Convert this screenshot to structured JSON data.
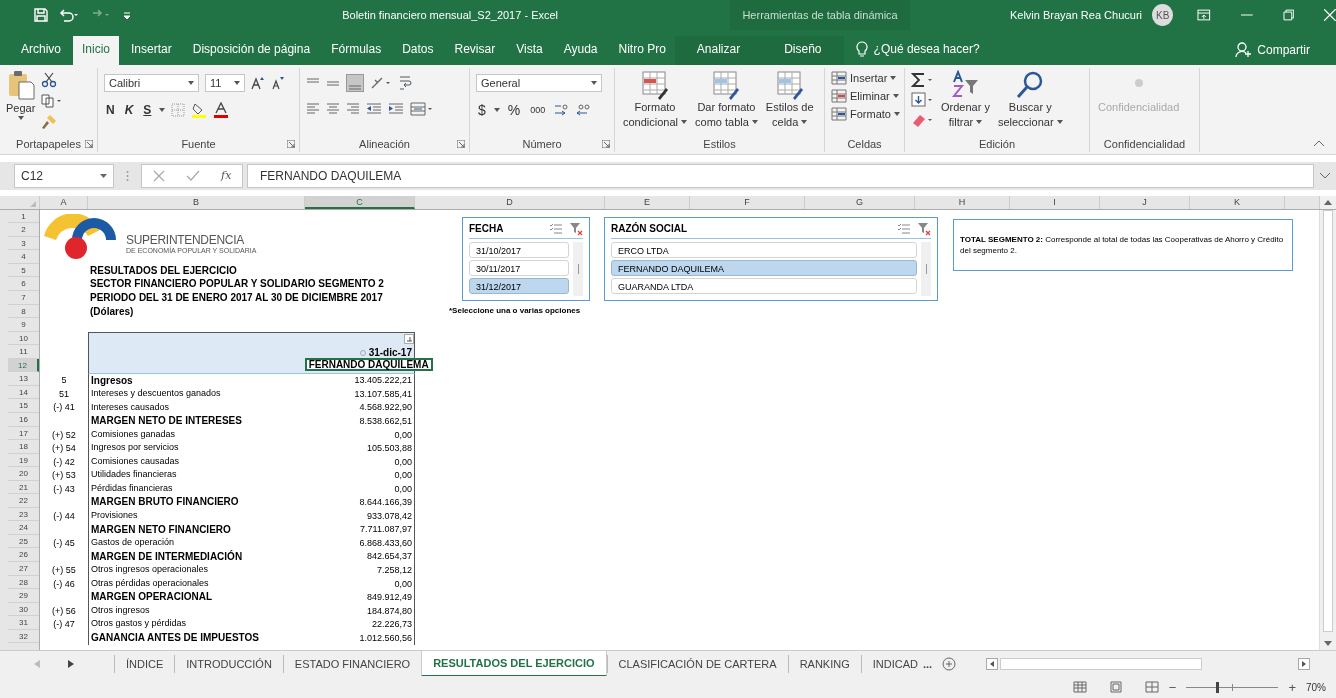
{
  "window": {
    "title": "Boletin financiero mensual_S2_2017  -  Excel",
    "context_group": "Herramientas de tabla dinámica",
    "user": "Kelvin Brayan Rea Chucuri",
    "user_initials": "KB"
  },
  "ribbon_tabs": [
    {
      "label": "Archivo",
      "selected": false,
      "context": false
    },
    {
      "label": "Inicio",
      "selected": true,
      "context": false
    },
    {
      "label": "Insertar",
      "selected": false,
      "context": false
    },
    {
      "label": "Disposición de página",
      "selected": false,
      "context": false
    },
    {
      "label": "Fórmulas",
      "selected": false,
      "context": false
    },
    {
      "label": "Datos",
      "selected": false,
      "context": false
    },
    {
      "label": "Revisar",
      "selected": false,
      "context": false
    },
    {
      "label": "Vista",
      "selected": false,
      "context": false
    },
    {
      "label": "Ayuda",
      "selected": false,
      "context": false
    },
    {
      "label": "Nitro Pro",
      "selected": false,
      "context": false
    },
    {
      "label": "Analizar",
      "selected": false,
      "context": true
    },
    {
      "label": "Diseño",
      "selected": false,
      "context": true
    }
  ],
  "tell_me": "¿Qué desea hacer?",
  "share": "Compartir",
  "clipboard": {
    "paste": "Pegar",
    "label": "Portapapeles"
  },
  "font": {
    "name": "Calibri",
    "size": "11",
    "bold": "N",
    "italic": "K",
    "underline": "S",
    "label": "Fuente"
  },
  "alignment": {
    "label": "Alineación"
  },
  "number": {
    "format": "General",
    "currency": "$",
    "percent": "%",
    "thousands": "000",
    "label": "Número"
  },
  "styles": {
    "buttons": [
      [
        "Formato",
        "condicional"
      ],
      [
        "Dar formato",
        "como tabla"
      ],
      [
        "Estilos de",
        "celda"
      ]
    ],
    "label": "Estilos"
  },
  "cells": {
    "buttons": [
      "Insertar",
      "Eliminar",
      "Formato"
    ],
    "label": "Celdas"
  },
  "editing": {
    "buttons": [
      [
        "Ordenar y",
        "filtrar"
      ],
      [
        "Buscar y",
        "seleccionar"
      ]
    ],
    "label": "Edición"
  },
  "sensitivity": {
    "button": "Confidencialidad",
    "label": "Confidencialidad"
  },
  "formula_bar": {
    "name_box": "C12",
    "function_symbol": "fx",
    "content": "FERNANDO DAQUILEMA"
  },
  "columns": [
    {
      "label": "A",
      "selected": false
    },
    {
      "label": "B",
      "selected": false
    },
    {
      "label": "C",
      "selected": true
    },
    {
      "label": "D",
      "selected": false
    },
    {
      "label": "E",
      "selected": false
    },
    {
      "label": "F",
      "selected": false
    },
    {
      "label": "G",
      "selected": false
    },
    {
      "label": "H",
      "selected": false
    },
    {
      "label": "I",
      "selected": false
    },
    {
      "label": "J",
      "selected": false
    },
    {
      "label": "K",
      "selected": false
    }
  ],
  "row_headers": [
    {
      "label": "1",
      "selected": false
    },
    {
      "label": "2",
      "selected": false
    },
    {
      "label": "3",
      "selected": false
    },
    {
      "label": "4",
      "selected": false
    },
    {
      "label": "5",
      "selected": false
    },
    {
      "label": "6",
      "selected": false
    },
    {
      "label": "7",
      "selected": false
    },
    {
      "label": "8",
      "selected": false
    },
    {
      "label": "9",
      "selected": false
    },
    {
      "label": "10",
      "selected": false
    },
    {
      "label": "11",
      "selected": false
    },
    {
      "label": "12",
      "selected": true
    },
    {
      "label": "13",
      "selected": false
    },
    {
      "label": "14",
      "selected": false
    },
    {
      "label": "15",
      "selected": false
    },
    {
      "label": "16",
      "selected": false
    },
    {
      "label": "17",
      "selected": false
    },
    {
      "label": "18",
      "selected": false
    },
    {
      "label": "19",
      "selected": false
    },
    {
      "label": "20",
      "selected": false
    },
    {
      "label": "21",
      "selected": false
    },
    {
      "label": "22",
      "selected": false
    },
    {
      "label": "23",
      "selected": false
    },
    {
      "label": "24",
      "selected": false
    },
    {
      "label": "25",
      "selected": false
    },
    {
      "label": "26",
      "selected": false
    },
    {
      "label": "27",
      "selected": false
    },
    {
      "label": "28",
      "selected": false
    },
    {
      "label": "29",
      "selected": false
    },
    {
      "label": "30",
      "selected": false
    },
    {
      "label": "31",
      "selected": false
    },
    {
      "label": "32",
      "selected": false
    }
  ],
  "logo": {
    "name": "SUPERINTENDENCIA",
    "subtitle": "DE ECONOMÍA POPULAR Y SOLIDARIA"
  },
  "report_titles": [
    "RESULTADOS DEL EJERCICIO",
    "SECTOR FINANCIERO POPULAR Y SOLIDARIO SEGMENTO 2",
    "PERIODO DEL 31 DE ENERO 2017 AL 30 DE DICIEMBRE 2017",
    "(Dólares)"
  ],
  "pivot": {
    "date_header": "31-dic-17",
    "column_header": "FERNANDO DAQUILEMA",
    "rows": [
      {
        "code": "5",
        "label": "Ingresos",
        "value": "13.405.222,21",
        "bold": true
      },
      {
        "code": "51",
        "label": "Intereses y descuentos ganados",
        "value": "13.107.585,41",
        "bold": false
      },
      {
        "code": "(-) 41",
        "label": "Intereses causados",
        "value": "4.568.922,90",
        "bold": false
      },
      {
        "label": "MARGEN NETO DE INTERESES",
        "value": "8.538.662,51",
        "bold": true
      },
      {
        "code": "(+) 52",
        "label": "Comisiones ganadas",
        "value": "0,00",
        "bold": false
      },
      {
        "code": "(+) 54",
        "label": "Ingresos por servicios",
        "value": "105.503,88",
        "bold": false
      },
      {
        "code": "(-) 42",
        "label": "Comisiones causadas",
        "value": "0,00",
        "bold": false
      },
      {
        "code": "(+) 53",
        "label": "Utilidades financieras",
        "value": "0,00",
        "bold": false
      },
      {
        "code": "(-) 43",
        "label": "Pérdidas financieras",
        "value": "0,00",
        "bold": false
      },
      {
        "label": "MARGEN BRUTO FINANCIERO",
        "value": "8.644.166,39",
        "bold": true
      },
      {
        "code": "(-) 44",
        "label": "Provisiones",
        "value": "933.078,42",
        "bold": false
      },
      {
        "label": "MARGEN NETO FINANCIERO",
        "value": "7.711.087,97",
        "bold": true
      },
      {
        "code": "(-) 45",
        "label": "Gastos de operación",
        "value": "6.868.433,60",
        "bold": false
      },
      {
        "label": "MARGEN DE INTERMEDIACIÓN",
        "value": "842.654,37",
        "bold": true
      },
      {
        "code": "(+) 55",
        "label": "Otros ingresos operacionales",
        "value": "7.258,12",
        "bold": false
      },
      {
        "code": "(-) 46",
        "label": "Otras pérdidas operacionales",
        "value": "0,00",
        "bold": false
      },
      {
        "label": "MARGEN OPERACIONAL",
        "value": "849.912,49",
        "bold": true
      },
      {
        "code": "(+) 56",
        "label": "Otros ingresos",
        "value": "184.874,80",
        "bold": false
      },
      {
        "code": "(-) 47",
        "label": "Otros gastos y pérdidas",
        "value": "22.226,73",
        "bold": false
      },
      {
        "label": "GANANCIA ANTES DE IMPUESTOS",
        "value": "1.012.560,56",
        "bold": true
      }
    ]
  },
  "slicers": [
    {
      "title": "FECHA",
      "items": [
        {
          "label": "31/10/2017",
          "selected": false
        },
        {
          "label": "30/11/2017",
          "selected": false
        },
        {
          "label": "31/12/2017",
          "selected": true
        }
      ]
    },
    {
      "title": "RAZÓN SOCIAL",
      "items": [
        {
          "label": "ERCO LTDA",
          "selected": false
        },
        {
          "label": "FERNANDO DAQUILEMA",
          "selected": true
        },
        {
          "label": "GUARANDA LTDA",
          "selected": false
        }
      ]
    }
  ],
  "slicer_note": "*Seleccione una o varias opciones",
  "note_box": "**TOTAL SEGMENTO 2:**  Corresponde al total de todas las Cooperativas  de Ahorro y Crédito del segmento 2.",
  "sheet_tabs": [
    {
      "label": "ÍNDICE",
      "selected": false
    },
    {
      "label": "INTRODUCCIÓN",
      "selected": false
    },
    {
      "label": "ESTADO FINANCIERO",
      "selected": false
    },
    {
      "label": "RESULTADOS DEL EJERCICIO",
      "selected": true
    },
    {
      "label": "CLASIFICACIÓN DE CARTERA",
      "selected": false
    },
    {
      "label": "RANKING",
      "selected": false
    },
    {
      "label": "INDICAD",
      "selected": false
    }
  ],
  "more_tabs": "...",
  "status_bar": {
    "zoom": "70%",
    "zoom_minus": "−",
    "zoom_plus": "+",
    "zoom_slider": {
      "level": 0.33
    }
  }
}
